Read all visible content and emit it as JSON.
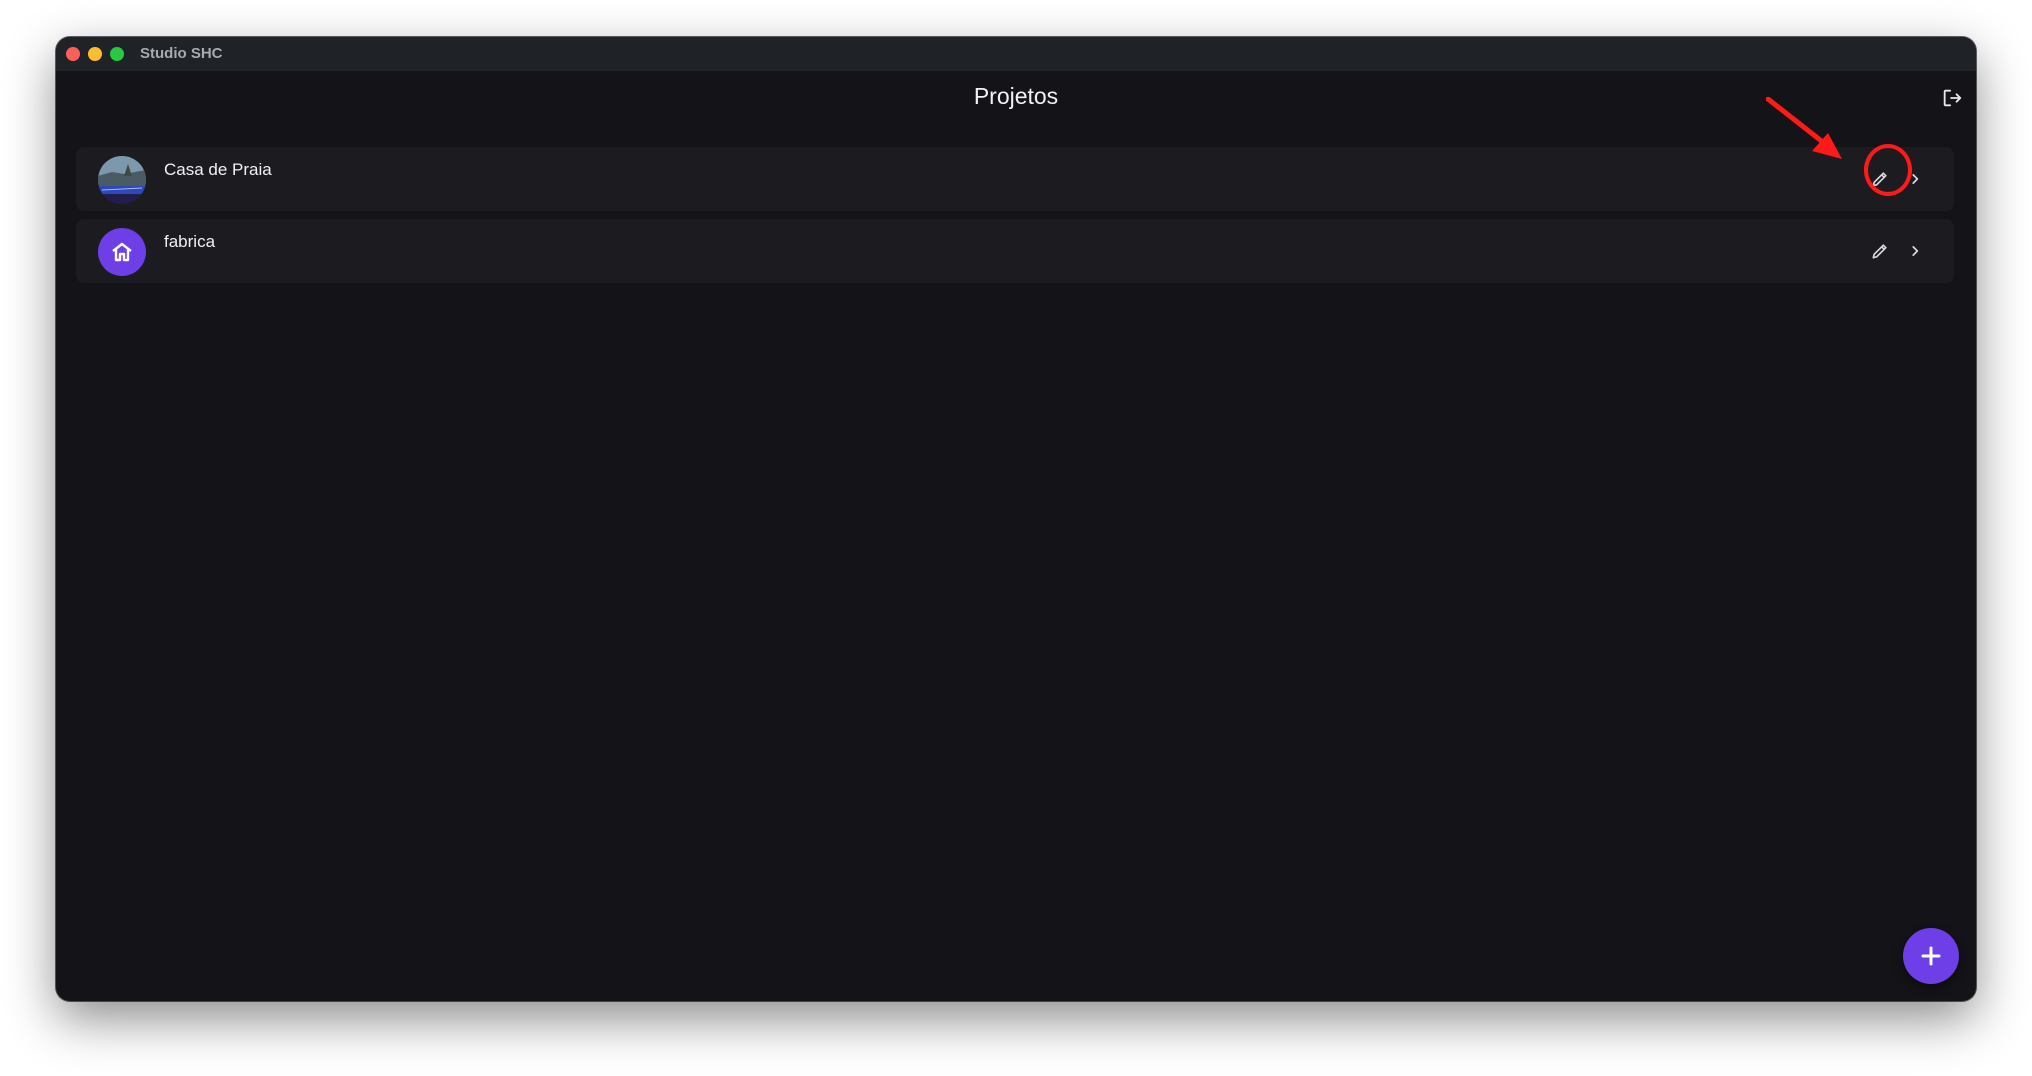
{
  "window": {
    "title": "Studio SHC"
  },
  "header": {
    "title": "Projetos",
    "logout_icon": "logout-icon"
  },
  "projects": [
    {
      "name": "Casa de Praia",
      "avatar": "photo",
      "edit_icon": "pencil-icon",
      "chevron_icon": "chevron-right-icon"
    },
    {
      "name": "fabrica",
      "avatar": "home-icon",
      "edit_icon": "pencil-icon",
      "chevron_icon": "chevron-right-icon"
    }
  ],
  "fab": {
    "icon": "plus-icon"
  },
  "colors": {
    "background": "#131318",
    "row": "#1b1b20",
    "accent": "#6e3fe6",
    "annotation": "#ff1a1a"
  }
}
